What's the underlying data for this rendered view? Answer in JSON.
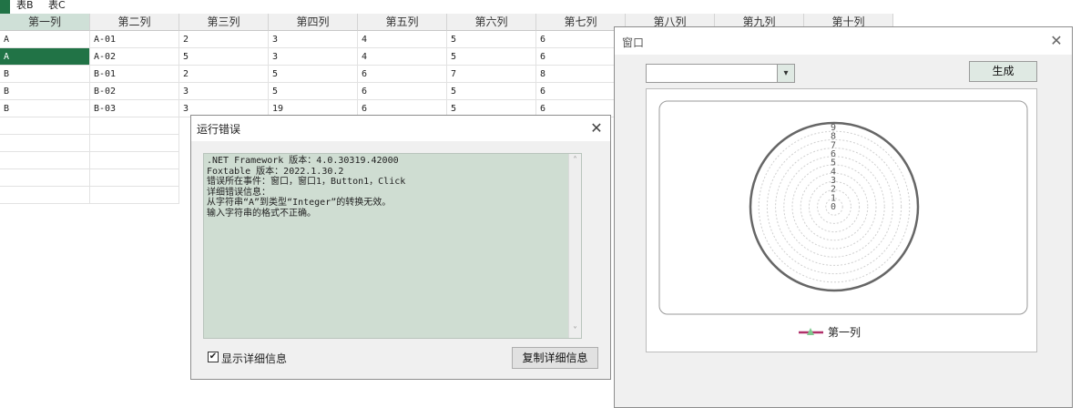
{
  "tabs": [
    "表B",
    "表C"
  ],
  "grid": {
    "headers": [
      "第一列",
      "第二列",
      "第三列",
      "第四列",
      "第五列",
      "第六列",
      "第七列",
      "第八列",
      "第九列",
      "第十列"
    ],
    "rows": [
      [
        "A",
        "A-01",
        "2",
        "3",
        "4",
        "5",
        "6"
      ],
      [
        "A",
        "A-02",
        "5",
        "3",
        "4",
        "5",
        "6"
      ],
      [
        "B",
        "B-01",
        "2",
        "5",
        "6",
        "7",
        "8"
      ],
      [
        "B",
        "B-02",
        "3",
        "5",
        "6",
        "5",
        "6"
      ],
      [
        "B",
        "B-03",
        "3",
        "19",
        "6",
        "5",
        "6"
      ]
    ]
  },
  "error_dialog": {
    "title": "运行错误",
    "close": "✕",
    "lines": [
      ".NET Framework 版本：4.0.30319.42000",
      "Foxtable 版本：2022.1.30.2",
      "错误所在事件：窗口，窗口1，Button1，Click",
      "详细错误信息：",
      "从字符串“A”到类型“Integer”的转换无效。",
      "输入字符串的格式不正确。"
    ],
    "scroll_up": "˄",
    "scroll_down": "˅",
    "checkbox_label": "显示详细信息",
    "checkbox_mark": "✔",
    "copy_button": "复制详细信息"
  },
  "window": {
    "title": "窗口",
    "close": "✕",
    "dropdown_value": "",
    "dropdown_arrow": "▾",
    "generate_button": "生成"
  },
  "chart_data": {
    "type": "radar",
    "ticks": [
      "0",
      "1",
      "2",
      "3",
      "4",
      "5",
      "6",
      "7",
      "8",
      "9"
    ],
    "series": [
      {
        "name": "第一列",
        "values": [],
        "color": "#b0306a"
      }
    ],
    "legend_marker_color": "#7fc98f",
    "grid": true,
    "legend_position": "bottom"
  },
  "colors": {
    "accent": "#217346",
    "header_selected": "#cfe0d7",
    "error_text_bg": "#cfddd2"
  }
}
